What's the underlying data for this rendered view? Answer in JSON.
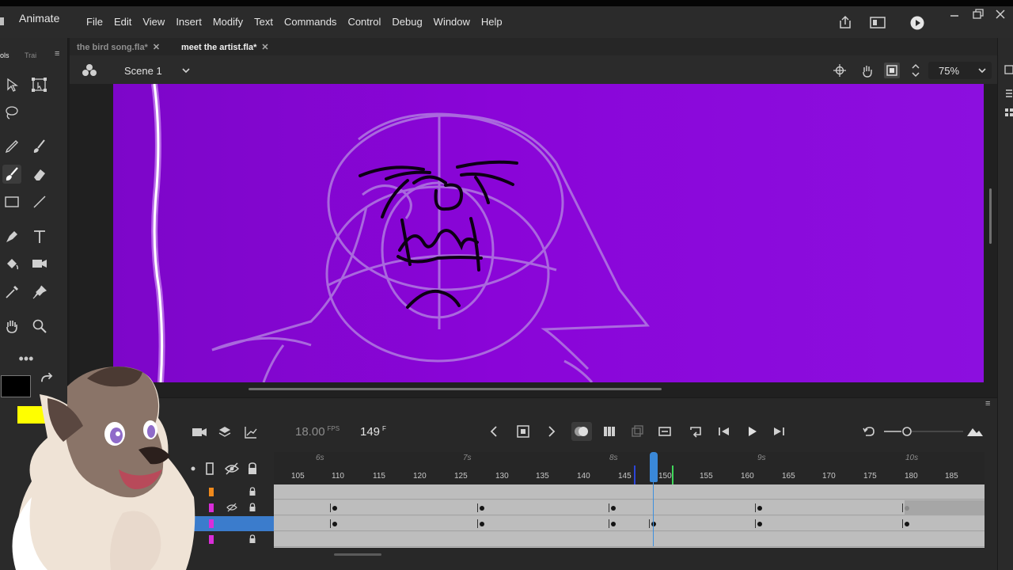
{
  "app": {
    "name": "Animate"
  },
  "menu": [
    "File",
    "Edit",
    "View",
    "Insert",
    "Modify",
    "Text",
    "Commands",
    "Control",
    "Debug",
    "Window",
    "Help"
  ],
  "tabs": [
    {
      "label": "the bird song.fla*",
      "active": false
    },
    {
      "label": "meet the artist.fla*",
      "active": true
    }
  ],
  "tools_panel": {
    "tab_tools": "ols",
    "tab_tra": "Trai"
  },
  "scene": {
    "label": "Scene 1"
  },
  "zoom": {
    "value": "75%"
  },
  "timeline": {
    "fps": "18.00",
    "fps_unit": "FPS",
    "frame": "149",
    "frame_unit": "F",
    "seconds": [
      "6s",
      "7s",
      "8s",
      "9s",
      "10s"
    ],
    "frame_ticks": [
      "105",
      "110",
      "115",
      "120",
      "125",
      "130",
      "135",
      "140",
      "145",
      "150",
      "155",
      "160",
      "165",
      "170",
      "175",
      "180",
      "185"
    ]
  },
  "colors": {
    "stage": "#8a05d8",
    "layer_orange": "#f08a1c",
    "layer_magenta": "#d92dd9",
    "playhead": "#3a88d8",
    "selection": "#3b7ccc"
  },
  "icons": [
    "share-icon",
    "panel-icon",
    "play-icon",
    "minimize-icon",
    "restore-icon",
    "close-icon"
  ]
}
